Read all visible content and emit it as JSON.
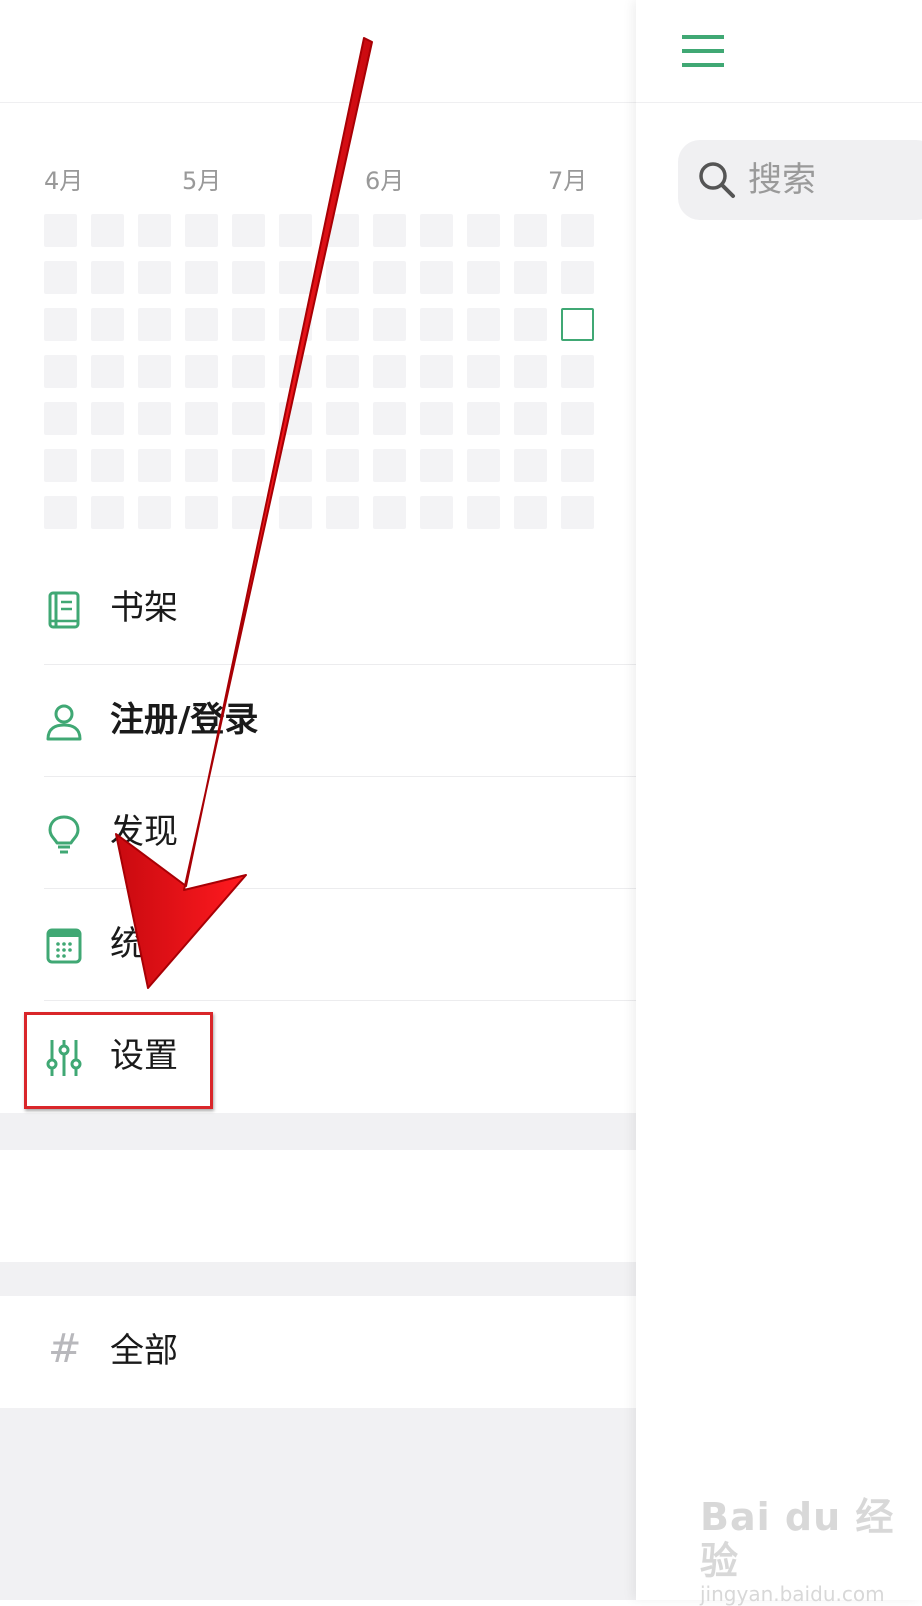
{
  "heatmap": {
    "months": [
      "4月",
      "5月",
      "6月",
      "7月"
    ],
    "rows": 7,
    "cols": 12,
    "today": {
      "row": 2,
      "col": 11
    }
  },
  "menu": {
    "items": [
      {
        "label": "书架",
        "icon": "bookshelf-icon"
      },
      {
        "label": "注册/登录",
        "icon": "user-icon"
      },
      {
        "label": "发现",
        "icon": "lightbulb-icon"
      },
      {
        "label": "统计",
        "icon": "calendar-icon"
      },
      {
        "label": "设置",
        "icon": "sliders-icon"
      }
    ],
    "tag_all": "全部"
  },
  "right_pane": {
    "search_placeholder": "搜索",
    "menu_icon": "hamburger-icon"
  },
  "watermark": {
    "main": "Bai du 经验",
    "sub": "jingyan.baidu.com"
  },
  "colors": {
    "accent": "#40a874",
    "annotation": "#e8141a"
  }
}
